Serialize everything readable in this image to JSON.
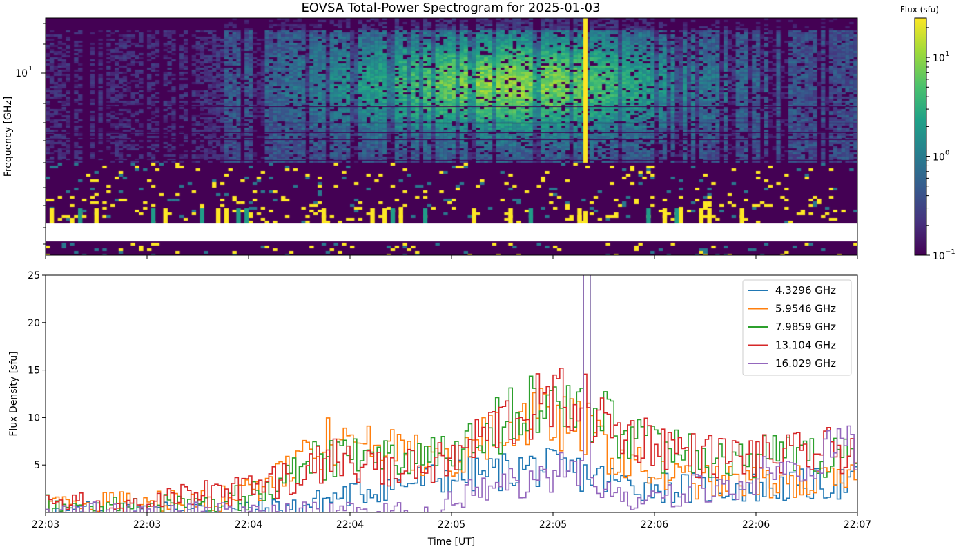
{
  "chart_data": [
    {
      "type": "heatmap",
      "title": "EOVSA Total-Power Spectrogram for 2025-01-03",
      "xlabel": "",
      "ylabel": "Frequency [GHz]",
      "y_scale": "log",
      "y_tick_label": "10",
      "y_tick_exponent": "1",
      "colorbar": {
        "label": "Flux (sfu)",
        "scale": "log",
        "range": [
          0.1,
          25
        ],
        "ticks": [
          {
            "base": "10",
            "exp": "−1"
          },
          {
            "base": "10",
            "exp": "0"
          },
          {
            "base": "10",
            "exp": "1"
          }
        ],
        "colormap": "viridis"
      },
      "features": [
        {
          "description_value": "broad emission band 3-17 GHz peaking near 22:05"
        },
        {
          "spike_time_fraction": 0.665
        }
      ]
    },
    {
      "type": "line",
      "title": "",
      "xlabel": "Time [UT]",
      "ylabel": "Flux Density [sfu]",
      "ylim": [
        0,
        25
      ],
      "y_ticks": [
        "5",
        "10",
        "15",
        "20",
        "25"
      ],
      "x_ticks": [
        "22:03",
        "22:03",
        "22:04",
        "22:04",
        "22:05",
        "22:05",
        "22:06",
        "22:06",
        "22:07"
      ],
      "legend_position": "top-right",
      "series": [
        {
          "name": "4.3296 GHz",
          "color": "#1f77b4",
          "profile": [
            [
              0,
              0
            ],
            [
              0.3,
              0.4
            ],
            [
              0.4,
              2.5
            ],
            [
              0.47,
              3.5
            ],
            [
              0.5,
              3.8
            ],
            [
              0.55,
              4.2
            ],
            [
              0.6,
              4.8
            ],
            [
              0.65,
              4.3
            ],
            [
              0.7,
              3.2
            ],
            [
              0.75,
              2.8
            ],
            [
              0.8,
              2.5
            ],
            [
              0.9,
              2.7
            ],
            [
              1,
              3.2
            ]
          ]
        },
        {
          "name": "5.9546 GHz",
          "color": "#ff7f0e",
          "profile": [
            [
              0,
              0.8
            ],
            [
              0.1,
              0.9
            ],
            [
              0.2,
              1.2
            ],
            [
              0.25,
              2.2
            ],
            [
              0.3,
              4.5
            ],
            [
              0.35,
              7.5
            ],
            [
              0.4,
              6.5
            ],
            [
              0.45,
              6.3
            ],
            [
              0.5,
              5.5
            ],
            [
              0.55,
              8
            ],
            [
              0.6,
              10
            ],
            [
              0.65,
              9
            ],
            [
              0.67,
              8.5
            ],
            [
              0.7,
              5.8
            ],
            [
              0.75,
              4
            ],
            [
              0.8,
              3.2
            ],
            [
              0.9,
              3.2
            ],
            [
              1,
              3.2
            ]
          ]
        },
        {
          "name": "7.9859 GHz",
          "color": "#2ca02c",
          "profile": [
            [
              0,
              0.7
            ],
            [
              0.1,
              0.5
            ],
            [
              0.2,
              1
            ],
            [
              0.25,
              1.8
            ],
            [
              0.3,
              4
            ],
            [
              0.35,
              6.2
            ],
            [
              0.4,
              6.3
            ],
            [
              0.45,
              5.5
            ],
            [
              0.5,
              5.7
            ],
            [
              0.55,
              9
            ],
            [
              0.6,
              11
            ],
            [
              0.65,
              12
            ],
            [
              0.67,
              11
            ],
            [
              0.7,
              9
            ],
            [
              0.75,
              6.5
            ],
            [
              0.8,
              6
            ],
            [
              0.9,
              6
            ],
            [
              1,
              5.8
            ]
          ]
        },
        {
          "name": "13.104 GHz",
          "color": "#d62728",
          "profile": [
            [
              0,
              1
            ],
            [
              0.1,
              0.5
            ],
            [
              0.2,
              2
            ],
            [
              0.25,
              2.5
            ],
            [
              0.3,
              3.5
            ],
            [
              0.35,
              5.5
            ],
            [
              0.4,
              4.8
            ],
            [
              0.45,
              4.5
            ],
            [
              0.5,
              5.5
            ],
            [
              0.55,
              9
            ],
            [
              0.6,
              11
            ],
            [
              0.65,
              12
            ],
            [
              0.67,
              10.5
            ],
            [
              0.7,
              8.5
            ],
            [
              0.75,
              7.5
            ],
            [
              0.8,
              6
            ],
            [
              0.9,
              5.8
            ],
            [
              1,
              6.8
            ]
          ]
        },
        {
          "name": "16.029 GHz",
          "color": "#9467bd",
          "profile": [
            [
              0,
              0
            ],
            [
              0.45,
              0
            ],
            [
              0.48,
              0.2
            ],
            [
              0.5,
              1.5
            ],
            [
              0.55,
              2.5
            ],
            [
              0.6,
              3.5
            ],
            [
              0.65,
              5
            ],
            [
              0.67,
              3
            ],
            [
              0.7,
              1.5
            ],
            [
              0.75,
              1.5
            ],
            [
              0.8,
              2.5
            ],
            [
              0.85,
              3
            ],
            [
              0.9,
              4.5
            ],
            [
              0.95,
              6
            ],
            [
              1,
              7
            ]
          ]
        }
      ],
      "spike": {
        "time_fraction": 0.665,
        "peak": 30
      }
    }
  ]
}
